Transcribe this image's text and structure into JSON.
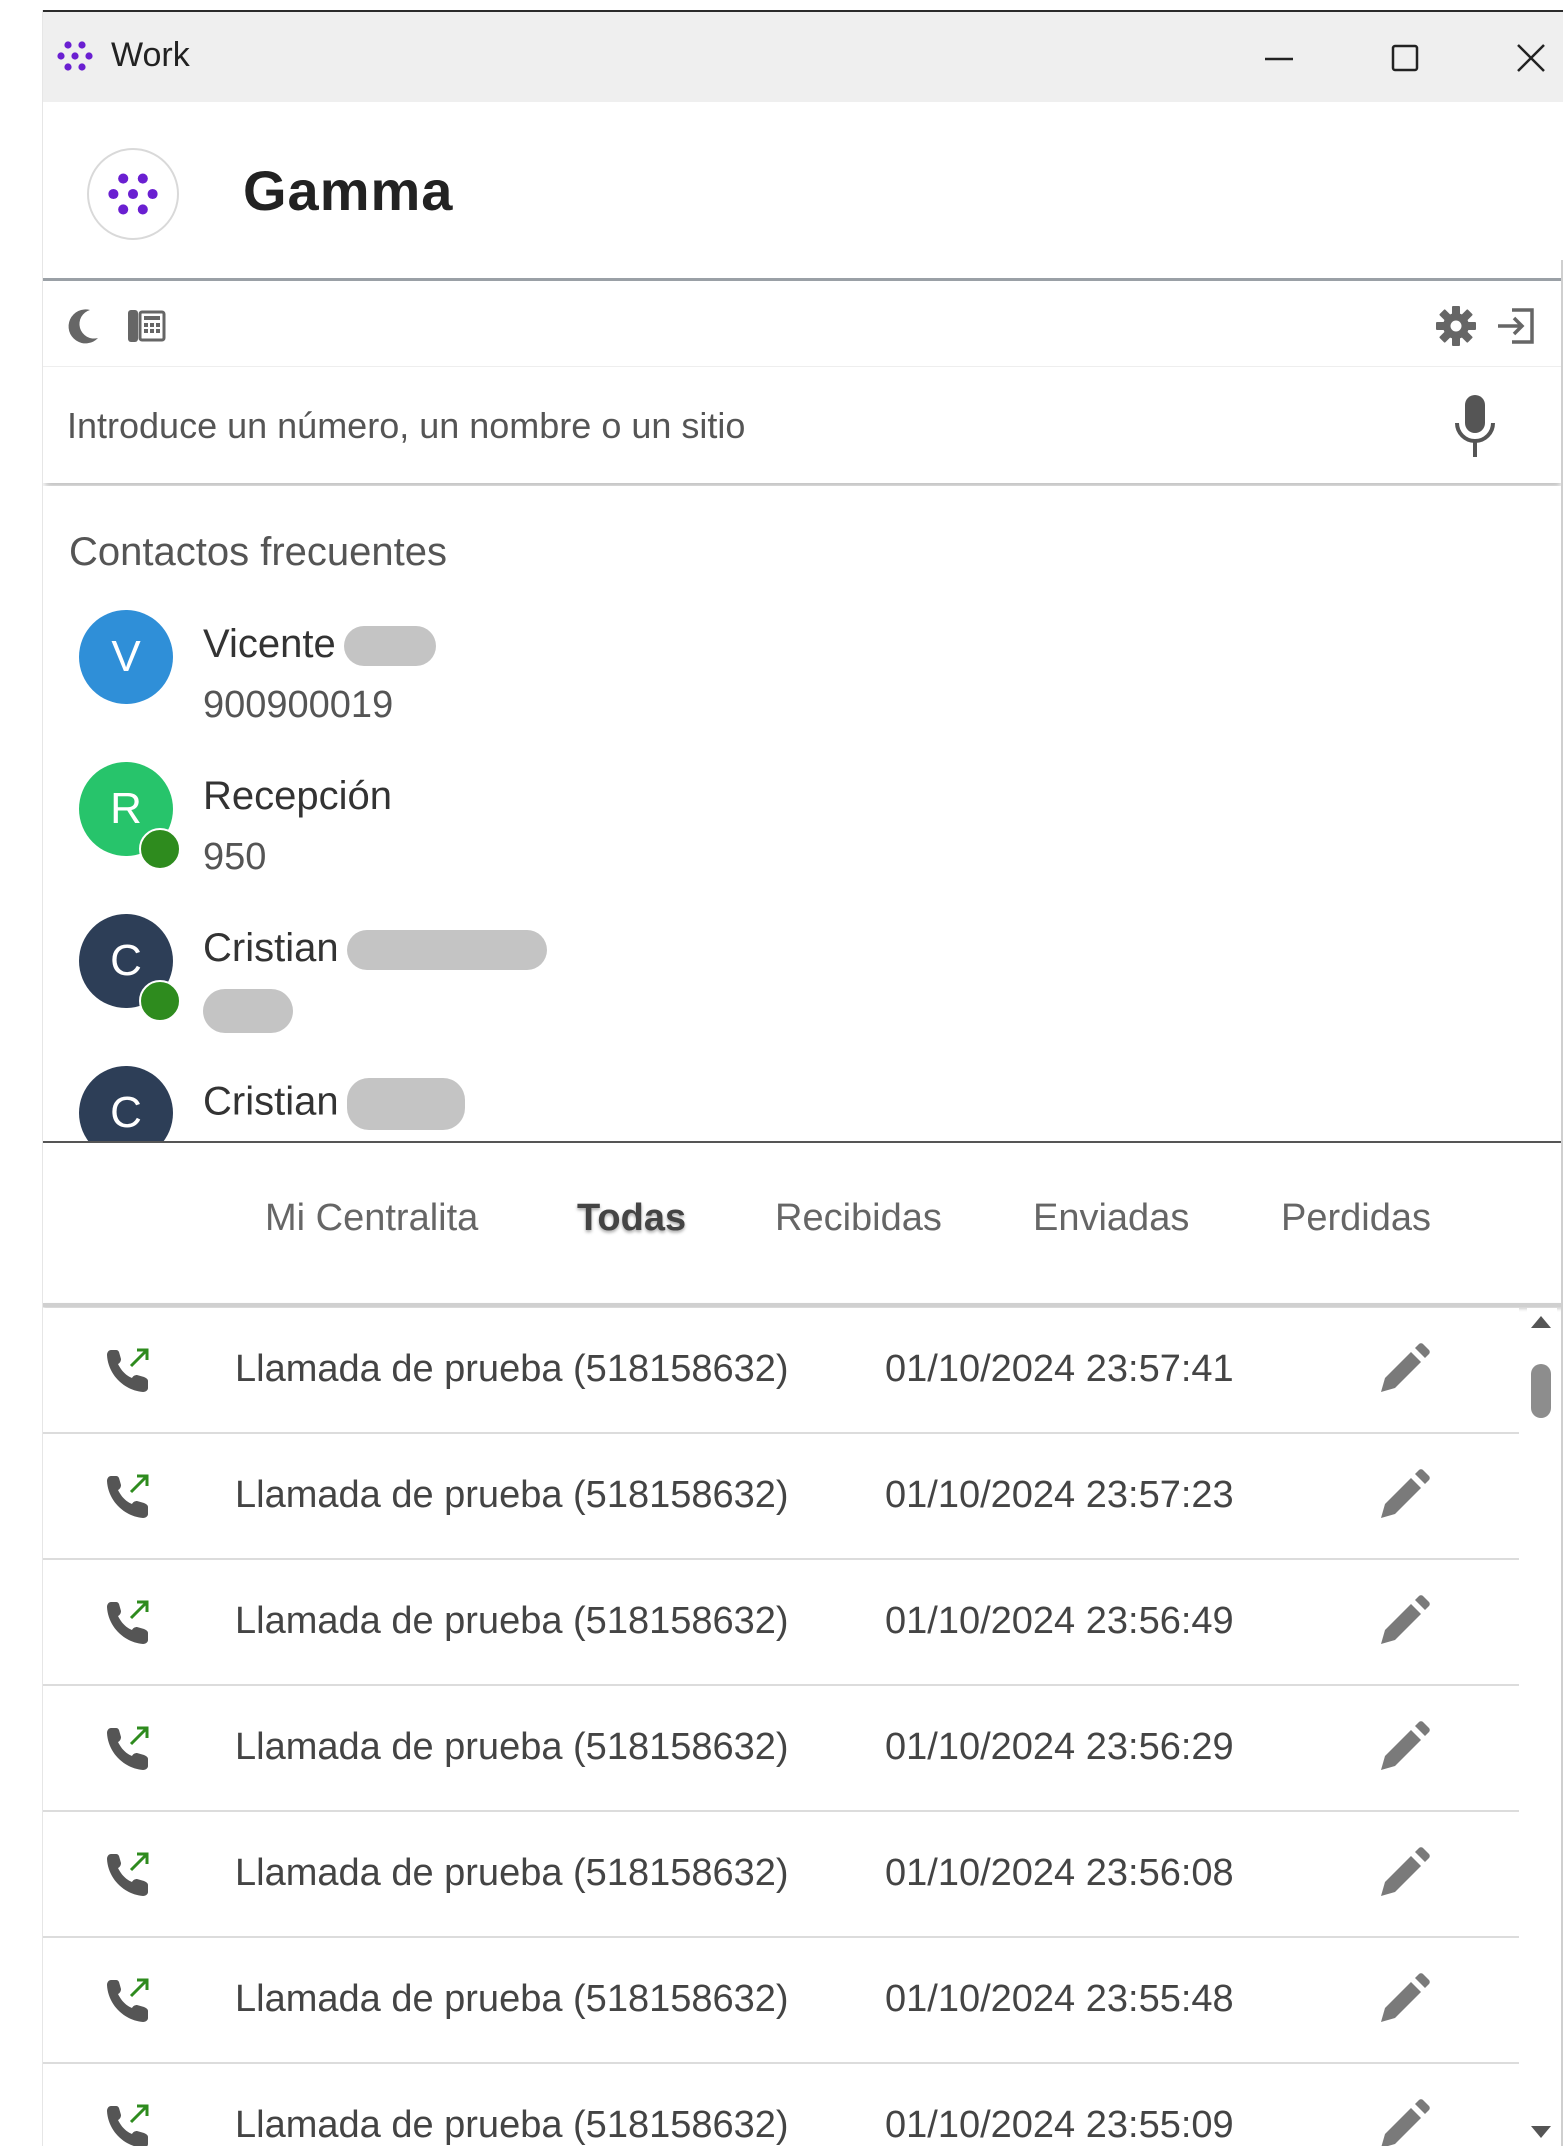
{
  "window": {
    "title": "Work"
  },
  "header": {
    "brand": "Gamma"
  },
  "search": {
    "placeholder": "Introduce un número, un nombre o un sitio"
  },
  "frequent": {
    "title": "Contactos frecuentes",
    "contacts": [
      {
        "initial": "V",
        "name": "Vicente",
        "number": "900900019",
        "color": "#2f8fd8",
        "online": false
      },
      {
        "initial": "R",
        "name": "Recepción",
        "number": "950",
        "color": "#27c46b",
        "online": true
      },
      {
        "initial": "C",
        "name": "Cristian",
        "number": "",
        "color": "#2d3e57",
        "online": true
      },
      {
        "initial": "C",
        "name": "Cristian",
        "number": "",
        "color": "#2d3e57",
        "online": false
      }
    ]
  },
  "tabs": [
    {
      "label": "Mi Centralita",
      "active": false
    },
    {
      "label": "Todas",
      "active": true
    },
    {
      "label": "Recibidas",
      "active": false
    },
    {
      "label": "Enviadas",
      "active": false
    },
    {
      "label": "Perdidas",
      "active": false
    }
  ],
  "calls": [
    {
      "name": "Llamada de prueba (518158632)",
      "date": "01/10/2024 23:57:41",
      "icon": "outgoing-call-icon"
    },
    {
      "name": "Llamada de prueba (518158632)",
      "date": "01/10/2024 23:57:23",
      "icon": "outgoing-call-icon"
    },
    {
      "name": "Llamada de prueba (518158632)",
      "date": "01/10/2024 23:56:49",
      "icon": "outgoing-call-icon"
    },
    {
      "name": "Llamada de prueba (518158632)",
      "date": "01/10/2024 23:56:29",
      "icon": "outgoing-call-icon"
    },
    {
      "name": "Llamada de prueba (518158632)",
      "date": "01/10/2024 23:56:08",
      "icon": "outgoing-call-icon"
    },
    {
      "name": "Llamada de prueba (518158632)",
      "date": "01/10/2024 23:55:48",
      "icon": "outgoing-call-icon"
    },
    {
      "name": "Llamada de prueba (518158632)",
      "date": "01/10/2024 23:55:09",
      "icon": "outgoing-call-icon"
    }
  ],
  "colors": {
    "brand_purple": "#6a1fd1",
    "online_green": "#2e8b1e",
    "call_icon": "#2e8b1e"
  }
}
